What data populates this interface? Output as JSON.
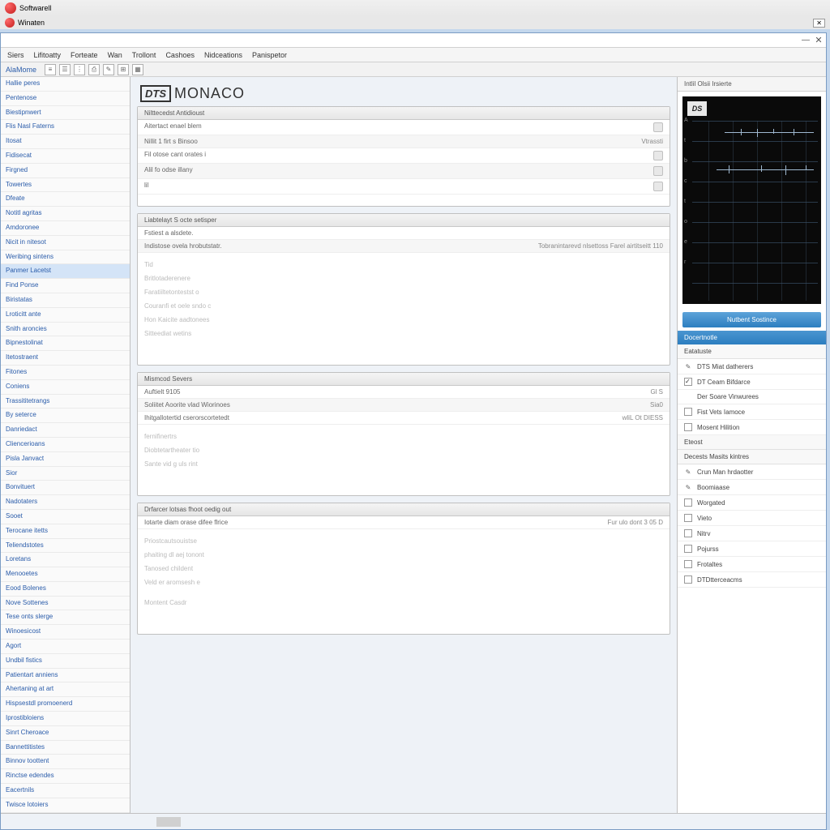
{
  "outer_title": "Softwarell",
  "secondary_title": "Winaten",
  "menu": [
    "Siers",
    "Lifitoatty",
    "Forteate",
    "Wan",
    "Trollont",
    "Cashoes",
    "Nidceations",
    "Panispetor"
  ],
  "toolbar_label": "AlaMome",
  "logo_prefix": "DTS",
  "logo_word": "MONACO",
  "sidebar": {
    "items": [
      "Hallie peres",
      "Pentenose",
      "Biestipnwert",
      "Flis Nasl Faterns",
      "Itosat",
      "Fidisecat",
      "Firgned",
      "Towertes",
      "Dfeate",
      "Notitl agritas",
      "Amdoronee",
      "Nicit in nitesot",
      "Weribing sintens",
      "Panmer Lacetst",
      "Find Ponse",
      "Biristatas",
      "Lroticitt ante",
      "Snith aroncies",
      "Bipnestolinat",
      "Itetostraent",
      "Fitones",
      "Coniens",
      "Trassititetrangs",
      "By seterce",
      "Danriedact",
      "Cliencerioans",
      "Pisla Janvact",
      "Sior",
      "Bonvituert",
      "Nadotaters",
      "Sooet",
      "Terocane itetts",
      "Teliendstotes",
      "Loretans",
      "Menooetes",
      "Eood Bolenes",
      "Nove Sottenes",
      "Tese onts slerge",
      "Winoesicost",
      "Agort",
      "Undbil fistics",
      "Patientart anniens",
      "Ahertaning at art",
      "Hispsestdl promoenerd",
      "Iprostibloiens",
      "Sinrt Cheroace",
      "Bannettitistes",
      "Binnov toottent",
      "Rinctse edendes",
      "Eacertnils",
      "Twisce lotoiers"
    ],
    "selected_index": 13
  },
  "panels": [
    {
      "title": "Nilttecedst Antidioust",
      "rows": [
        {
          "label": "Aitertact enael blem",
          "val": "",
          "badge": true
        },
        {
          "label": "Nillit 1 firt s Binsoo",
          "val": "Vtrassti",
          "badge": false
        },
        {
          "label": "Fil otose cant orates i",
          "val": "",
          "badge": true
        },
        {
          "label": "Alil fo odse illany",
          "val": "",
          "badge": true
        },
        {
          "label": "lil",
          "val": "",
          "badge": true
        }
      ],
      "lines": []
    },
    {
      "title": "Liabtelayt S octe setisper",
      "rows": [
        {
          "label": "Fstiest a alsdete.",
          "val": "",
          "badge": false
        },
        {
          "label": "Indistose ovela hrobutstatr.",
          "val": "Tobranintarevd nlsettoss     Farel    airtitseitt 110",
          "badge": false
        }
      ],
      "lines": [
        "Tid",
        "Britlotaderenere",
        "Faratiiltetontestst o",
        "Couranfi et oele sndo c",
        "Hon Kaicite aadtonees",
        "Sitteediat wetins"
      ]
    },
    {
      "title": "Mismcod Severs",
      "rows": [
        {
          "label": "Auftielt 9105",
          "val": "Gl S",
          "badge": false
        },
        {
          "label": "Soliitet Aoorite vlad Wiorinoes",
          "val": "Sia0",
          "badge": false
        },
        {
          "label": "Ihitgallotertid cserorscortetedt",
          "val": "wliL Ot DIESS",
          "badge": false
        }
      ],
      "lines": [
        "fernifinertrs",
        "Diobtetartheater tio",
        "Sante vid g uls rint"
      ]
    },
    {
      "title": "Drfarcer lotsas fhoot oedig out",
      "rows": [
        {
          "label": "Iotarte diam orase difee flrice",
          "val": "Fur ulo  dont 3 05 D",
          "badge": false
        }
      ],
      "lines": [
        "Priostcautsouistse",
        "phaiting dl aej tonont",
        "Tanosed childent",
        "Veld er aromsesh e",
        "",
        "Montent Casdr"
      ]
    }
  ],
  "right": {
    "header": "Intlil Olsii Irsierte",
    "scope_ticks": [
      "A",
      "t",
      "b",
      "c",
      "t",
      "o",
      "e",
      "r"
    ],
    "button_label": "Nutbent Sostince",
    "section1_header": "Docertnotle",
    "section1_sub": "Eatatuste",
    "section1_items": [
      {
        "checked": true,
        "pencil": true,
        "label": "DTS Miat datherers"
      },
      {
        "checked": true,
        "pencil": false,
        "label": "DT Ceam Bifdarce"
      },
      {
        "checked": false,
        "pencil": false,
        "label": "Der Soare Vinwurees",
        "nocheck": true
      },
      {
        "checked": false,
        "pencil": false,
        "label": "Fist Vets Iamoce"
      },
      {
        "checked": false,
        "pencil": false,
        "label": "Mosent Hilition"
      }
    ],
    "section2_sub": "Eteost",
    "section2_sub2": "Decests Masits kintres",
    "section2_items": [
      {
        "pencil": true,
        "label": "Crun Man hrdaotter"
      },
      {
        "pencil": true,
        "label": "Boomiaase"
      },
      {
        "label": "Worgated"
      },
      {
        "label": "Vieto"
      },
      {
        "label": "Nitrv"
      },
      {
        "label": "Pojurss"
      },
      {
        "label": "Frotaltes"
      },
      {
        "label": "DTDtterceacms"
      }
    ]
  }
}
